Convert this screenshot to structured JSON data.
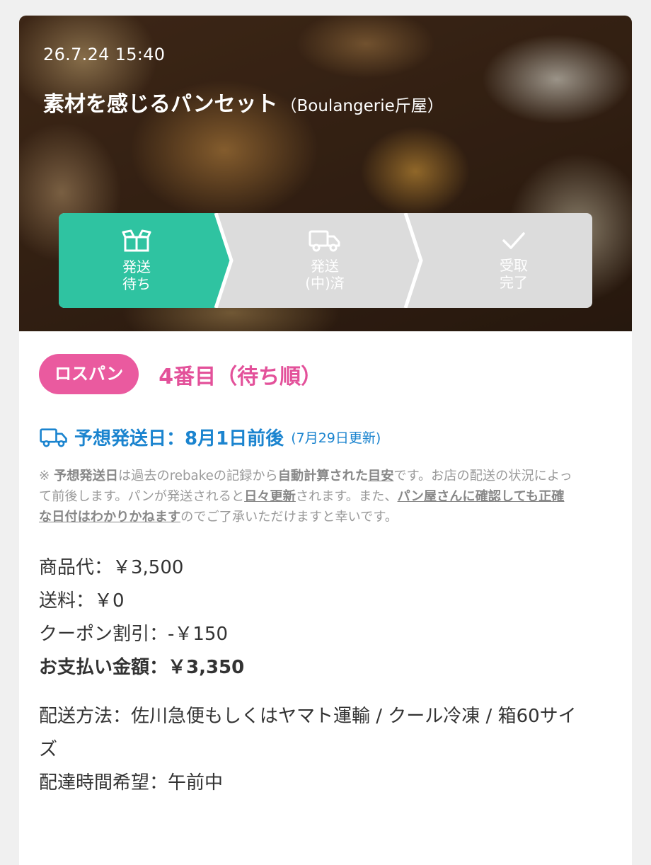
{
  "order": {
    "date": "26.7.24 15:40",
    "title": "素材を感じるパンセット",
    "shop": "（Boulangerie斤屋）"
  },
  "steps": [
    {
      "label": "発送\n待ち",
      "icon": "box-icon",
      "active": true
    },
    {
      "label": "発送\n(中)済",
      "icon": "truck-icon",
      "active": false
    },
    {
      "label": "受取\n完了",
      "icon": "check-icon",
      "active": false
    }
  ],
  "badge": {
    "label": "ロスパン",
    "rank": "4番目（待ち順）"
  },
  "shipping": {
    "estimate": "予想発送日：8月1日前後",
    "updated": "(7月29日更新)",
    "note": {
      "p1": "※ ",
      "b1": "予想発送日",
      "p2": "は過去のrebakeの記録から",
      "b2": "自動計算された",
      "b3": "目安",
      "p3": "です。お店の配送の状況によって前後します。パンが発送されると",
      "b4": "日々更新",
      "p4": "されます。また、",
      "b5": "パン屋さんに確認しても正確な日付はわかりかねます",
      "p5": "のでご了承いただけますと幸いです。"
    }
  },
  "prices": {
    "item": "商品代：￥3,500",
    "shipping": "送料：￥0",
    "coupon": "クーポン割引：-￥150",
    "total": "お支払い金額：￥3,350"
  },
  "delivery": {
    "method": "配送方法：佐川急便もしくはヤマト運輸 / クール冷凍 / 箱60サイズ",
    "time": "配達時間希望：午前中"
  },
  "colors": {
    "active_step": "#2fc3a1",
    "inactive_step": "#dcdcdc",
    "pink": "#ea5a9f",
    "blue": "#1b84cf"
  }
}
